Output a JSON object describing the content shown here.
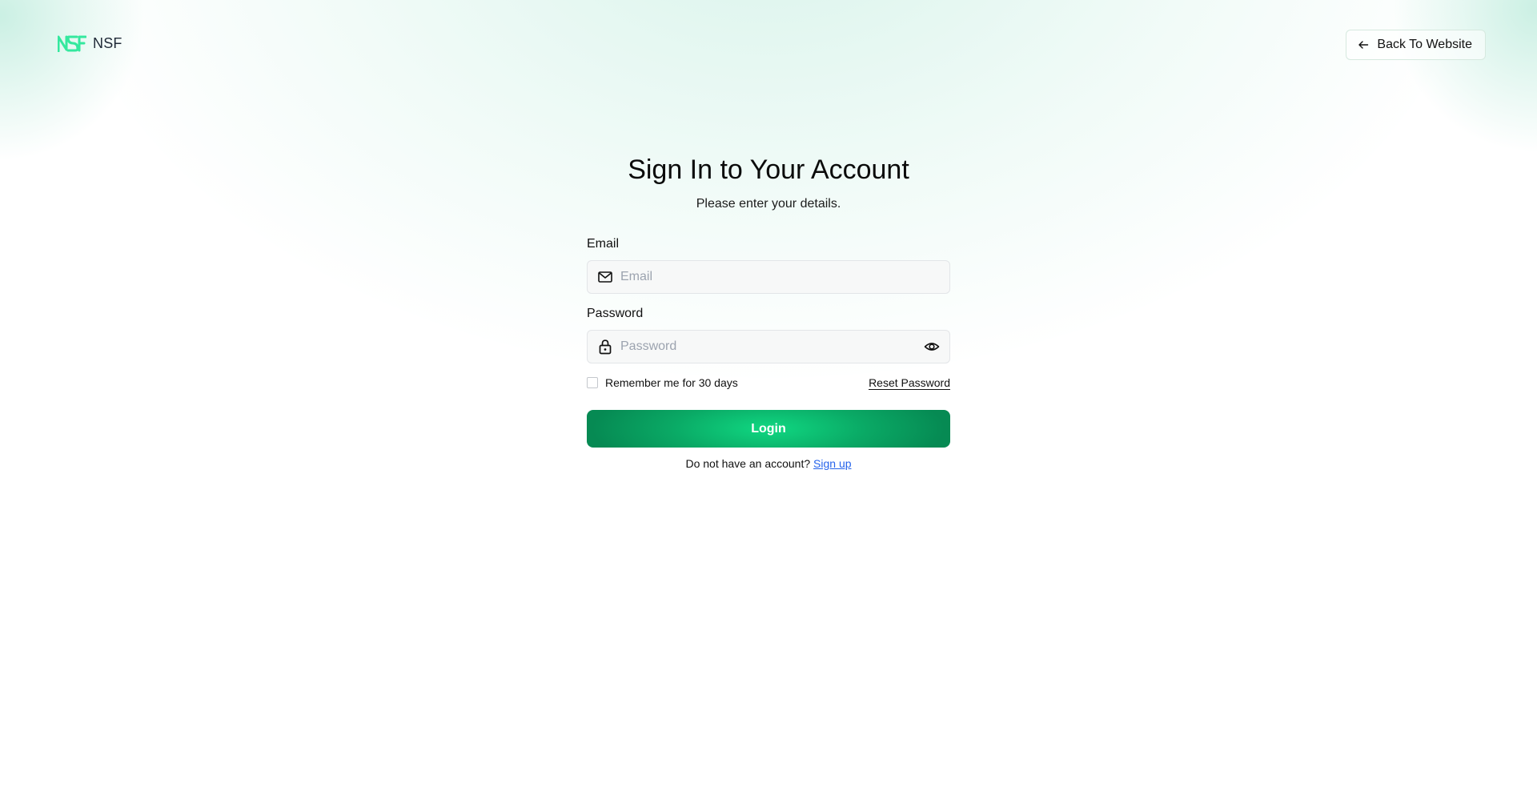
{
  "header": {
    "logo_text": "NSF",
    "logo_icon": "nsf-logo-icon",
    "back_label": "Back To Website",
    "back_icon": "arrow-left-icon"
  },
  "form": {
    "title": "Sign In to Your Account",
    "subtitle": "Please enter your details.",
    "email": {
      "label": "Email",
      "placeholder": "Email",
      "value": "",
      "icon": "mail-icon"
    },
    "password": {
      "label": "Password",
      "placeholder": "Password",
      "value": "",
      "icon": "lock-icon",
      "toggle_icon": "eye-icon"
    },
    "remember_label": "Remember me for 30 days",
    "remember_checked": false,
    "reset_label": "Reset Password",
    "login_label": "Login",
    "signup_prompt": "Do not have an account?",
    "signup_label": "Sign up"
  },
  "colors": {
    "accent": "#0aa965",
    "logo_green": "#34e89e",
    "link_blue": "#2563eb"
  }
}
